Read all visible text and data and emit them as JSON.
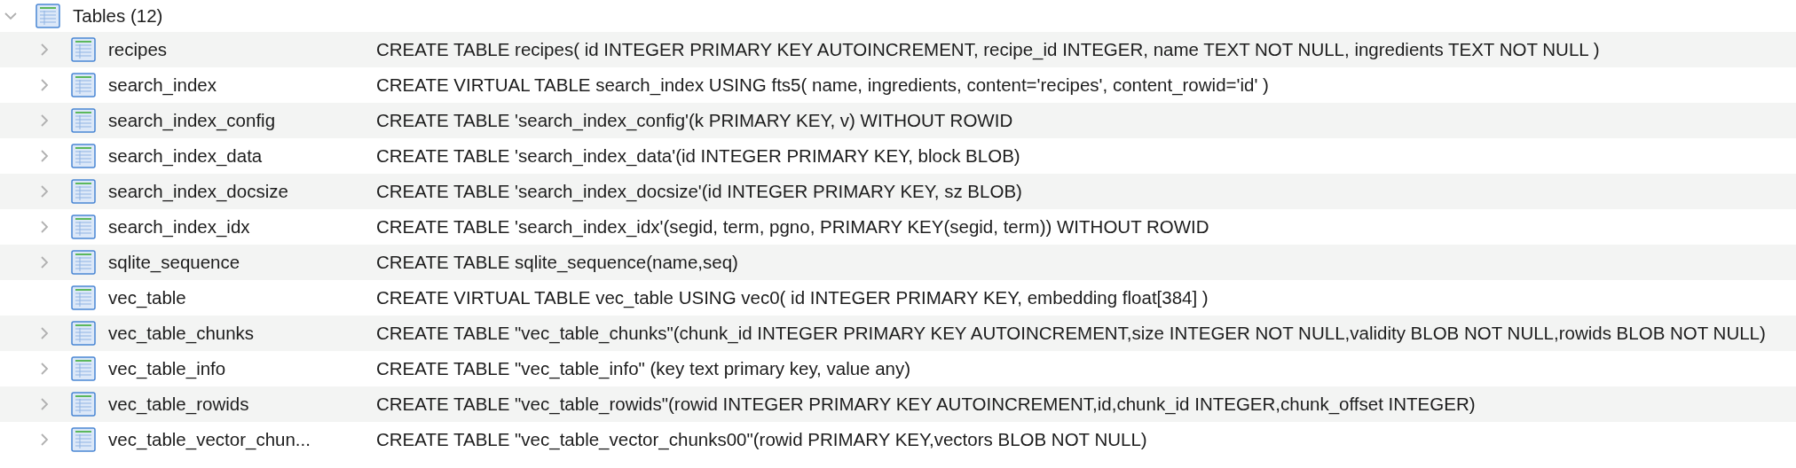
{
  "group": {
    "label": "Tables (12)",
    "expanded": true
  },
  "rows": [
    {
      "name": "recipes",
      "sql": "CREATE TABLE recipes( id INTEGER PRIMARY KEY AUTOINCREMENT, recipe_id INTEGER, name TEXT NOT NULL, ingredients TEXT NOT NULL )",
      "expandable": true
    },
    {
      "name": "search_index",
      "sql": "CREATE VIRTUAL TABLE search_index USING fts5( name, ingredients, content='recipes', content_rowid='id' )",
      "expandable": true
    },
    {
      "name": "search_index_config",
      "sql": "CREATE TABLE 'search_index_config'(k PRIMARY KEY, v) WITHOUT ROWID",
      "expandable": true
    },
    {
      "name": "search_index_data",
      "sql": "CREATE TABLE 'search_index_data'(id INTEGER PRIMARY KEY, block BLOB)",
      "expandable": true
    },
    {
      "name": "search_index_docsize",
      "sql": "CREATE TABLE 'search_index_docsize'(id INTEGER PRIMARY KEY, sz BLOB)",
      "expandable": true
    },
    {
      "name": "search_index_idx",
      "sql": "CREATE TABLE 'search_index_idx'(segid, term, pgno, PRIMARY KEY(segid, term)) WITHOUT ROWID",
      "expandable": true
    },
    {
      "name": "sqlite_sequence",
      "sql": "CREATE TABLE sqlite_sequence(name,seq)",
      "expandable": true
    },
    {
      "name": "vec_table",
      "sql": "CREATE VIRTUAL TABLE vec_table USING vec0( id INTEGER PRIMARY KEY, embedding float[384] )",
      "expandable": false
    },
    {
      "name": "vec_table_chunks",
      "sql": "CREATE TABLE \"vec_table_chunks\"(chunk_id INTEGER PRIMARY KEY AUTOINCREMENT,size INTEGER NOT NULL,validity BLOB NOT NULL,rowids BLOB NOT NULL)",
      "expandable": true
    },
    {
      "name": "vec_table_info",
      "sql": "CREATE TABLE \"vec_table_info\" (key text primary key, value any)",
      "expandable": true
    },
    {
      "name": "vec_table_rowids",
      "sql": "CREATE TABLE \"vec_table_rowids\"(rowid INTEGER PRIMARY KEY AUTOINCREMENT,id,chunk_id INTEGER,chunk_offset INTEGER)",
      "expandable": true
    },
    {
      "name": "vec_table_vector_chun...",
      "sql": "CREATE TABLE \"vec_table_vector_chunks00\"(rowid PRIMARY KEY,vectors BLOB NOT NULL)",
      "expandable": true
    }
  ]
}
